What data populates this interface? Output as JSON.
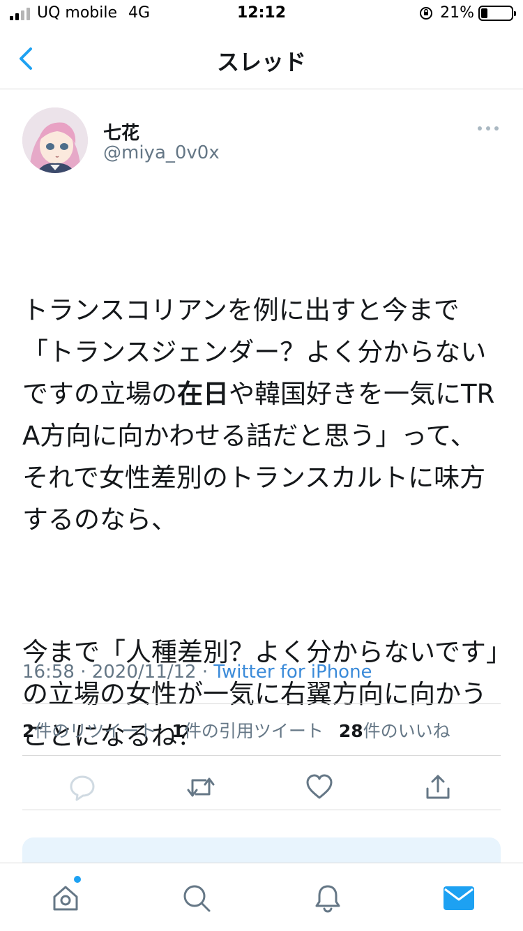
{
  "status_bar": {
    "carrier": "UQ mobile",
    "network": "4G",
    "time": "12:12",
    "battery_percent": "21%",
    "battery_level": 0.21,
    "signal_bars_filled": 2,
    "signal_bars_total": 4
  },
  "nav": {
    "title": "スレッド",
    "back_icon": "chevron-left-icon"
  },
  "tweet": {
    "display_name": "七花",
    "handle": "@miya_0v0x",
    "paragraphs": [
      [
        "トランスコリアンを例に出すと今まで「トランスジェンダー？よく分からないですの立場の",
        "在日",
        "や韓国好きを一気にTRA方向に向かわせる話だと思う」って、\nそれで女性差別のトランスカルトに味方するのなら、"
      ],
      [
        "今まで「人種差別？よく分からないです」の立場の女性が一気に右翼方向に向かうことになるね？"
      ]
    ],
    "timestamp": "16:58 · 2020/11/12 · ",
    "source": "Twitter for iPhone"
  },
  "stats": {
    "retweets_count": "2",
    "retweets_label": "件のリツイート",
    "quotes_count": "1",
    "quotes_label": "件の引用ツイート",
    "likes_count": "28",
    "likes_label": "件のいいね"
  },
  "colors": {
    "accent": "#1da1f2",
    "link": "#3b8bd9",
    "secondary_text": "#657786",
    "primary_text": "#14171a",
    "divider": "#d9d9d9"
  },
  "actions": [
    "reply-icon",
    "retweet-icon",
    "like-icon",
    "share-icon"
  ],
  "tab_bar": [
    "home-icon",
    "search-icon",
    "notifications-icon",
    "messages-icon"
  ]
}
